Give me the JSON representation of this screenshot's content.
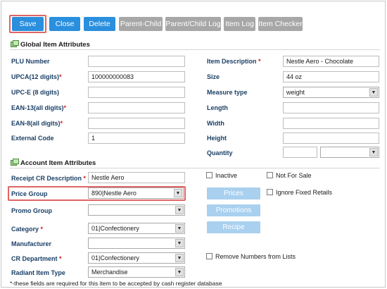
{
  "toolbar": {
    "save": "Save",
    "close": "Close",
    "delete": "Delete",
    "parent_child": "Parent-Child",
    "parent_child_log": "Parent/Child Log",
    "item_log": "Item Log",
    "item_checker": "Item Checker"
  },
  "global": {
    "heading": "Global Item Attributes",
    "plu_number": {
      "label": "PLU Number",
      "value": ""
    },
    "upca": {
      "label": "UPCA(12 digits)",
      "req": "*",
      "value": "100000000083"
    },
    "upce": {
      "label": "UPC-E (8 digits)",
      "value": ""
    },
    "ean13": {
      "label": "EAN-13(all digits)",
      "req": "*",
      "value": ""
    },
    "ean8": {
      "label": "EAN-8(all digits)",
      "req": "*",
      "value": ""
    },
    "external_code": {
      "label": "External Code",
      "value": "1"
    },
    "item_description": {
      "label": "Item Description",
      "req": "*",
      "value": "Nestle Aero - Chocolate"
    },
    "size": {
      "label": "Size",
      "value": "44 oz"
    },
    "measure_type": {
      "label": "Measure type",
      "value": "weight"
    },
    "length": {
      "label": "Length",
      "value": ""
    },
    "width": {
      "label": "Width",
      "value": ""
    },
    "height": {
      "label": "Height",
      "value": ""
    },
    "quantity": {
      "label": "Quantity",
      "value": "",
      "unit": ""
    }
  },
  "account": {
    "heading": "Account Item Attributes",
    "receipt_cr_description": {
      "label": "Receipt CR Description",
      "req": "*",
      "value": "Nestle Aero"
    },
    "price_group": {
      "label": "Price Group",
      "value": "890|Nestle Aero"
    },
    "promo_group": {
      "label": "Promo Group",
      "value": ""
    },
    "category": {
      "label": "Category",
      "req": "*",
      "value": "01|Confectionery"
    },
    "manufacturer": {
      "label": "Manufacturer",
      "value": ""
    },
    "cr_department": {
      "label": "CR Department",
      "req": "*",
      "value": "01|Confectionery"
    },
    "radiant_item_type": {
      "label": "Radiant Item Type",
      "value": "Merchandise"
    },
    "inactive": "Inactive",
    "not_for_sale": "Not For Sale",
    "ignore_fixed_retails": "Ignore Fixed Retails",
    "remove_numbers": "Remove Numbers from Lists",
    "prices_btn": "Prices",
    "promotions_btn": "Promotions",
    "recipe_btn": "Recipe"
  },
  "footnote": "*-these fields are required for this item to be accepted by cash register database",
  "colors": {
    "primary_button": "#2a8fdd",
    "disabled_button": "#a7a7a7",
    "highlight": "#e06464",
    "label_text": "#1a3f66",
    "required_star": "#d02020"
  },
  "icons": {
    "section_icon": "section-grid-icon",
    "dropdown": "chevron-down-icon"
  }
}
